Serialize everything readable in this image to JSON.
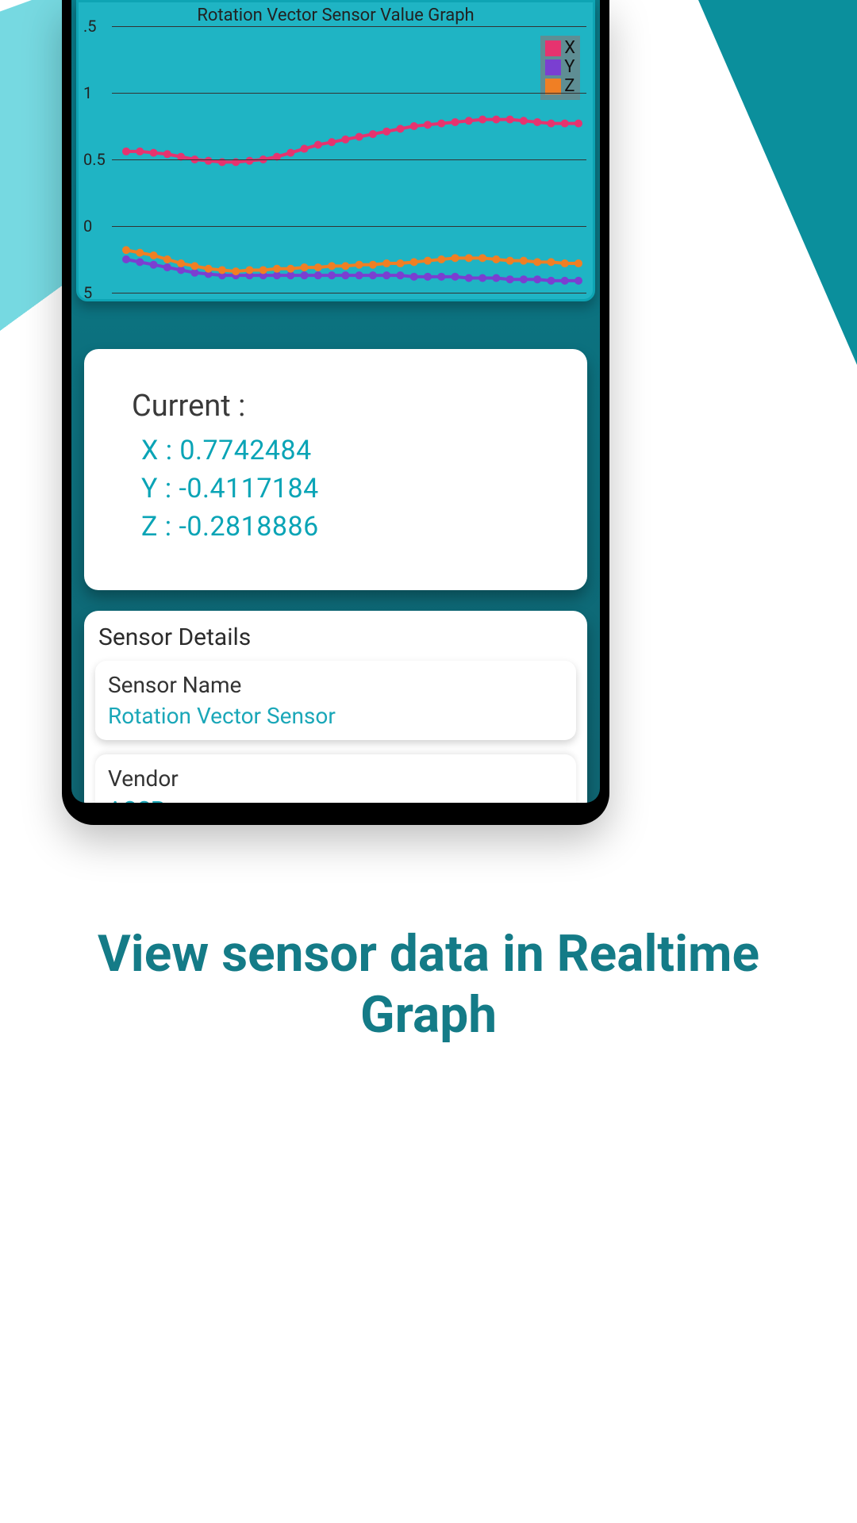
{
  "chart": {
    "title": "Rotation Vector Sensor Value Graph",
    "legend": {
      "x": "X",
      "y": "Y",
      "z": "Z"
    },
    "colors": {
      "x": "#e6336f",
      "y": "#7a3fd1",
      "z": "#f07f24"
    },
    "yticks": [
      ".5",
      "1",
      "0.5",
      "0",
      "5"
    ]
  },
  "chart_data": {
    "type": "line",
    "title": "Rotation Vector Sensor Value Graph",
    "xlabel": "",
    "ylabel": "",
    "ylim": [
      -0.5,
      1.5
    ],
    "x": [
      0,
      1,
      2,
      3,
      4,
      5,
      6,
      7,
      8,
      9,
      10,
      11,
      12,
      13,
      14,
      15,
      16,
      17,
      18,
      19,
      20,
      21,
      22,
      23,
      24,
      25,
      26,
      27,
      28,
      29,
      30,
      31,
      32,
      33
    ],
    "series": [
      {
        "name": "X",
        "color": "#e6336f",
        "values": [
          0.56,
          0.56,
          0.55,
          0.54,
          0.52,
          0.5,
          0.49,
          0.48,
          0.48,
          0.49,
          0.5,
          0.52,
          0.55,
          0.58,
          0.61,
          0.63,
          0.65,
          0.67,
          0.69,
          0.71,
          0.73,
          0.75,
          0.76,
          0.77,
          0.78,
          0.79,
          0.8,
          0.8,
          0.8,
          0.79,
          0.78,
          0.77,
          0.77,
          0.77
        ]
      },
      {
        "name": "Y",
        "color": "#7a3fd1",
        "values": [
          -0.25,
          -0.27,
          -0.29,
          -0.31,
          -0.33,
          -0.35,
          -0.36,
          -0.37,
          -0.37,
          -0.37,
          -0.37,
          -0.37,
          -0.37,
          -0.37,
          -0.37,
          -0.37,
          -0.37,
          -0.37,
          -0.37,
          -0.37,
          -0.37,
          -0.38,
          -0.38,
          -0.38,
          -0.38,
          -0.39,
          -0.39,
          -0.39,
          -0.4,
          -0.4,
          -0.4,
          -0.41,
          -0.41,
          -0.41
        ]
      },
      {
        "name": "Z",
        "color": "#f07f24",
        "values": [
          -0.18,
          -0.2,
          -0.22,
          -0.25,
          -0.28,
          -0.3,
          -0.32,
          -0.33,
          -0.34,
          -0.33,
          -0.33,
          -0.32,
          -0.32,
          -0.31,
          -0.31,
          -0.3,
          -0.3,
          -0.29,
          -0.29,
          -0.28,
          -0.28,
          -0.27,
          -0.26,
          -0.25,
          -0.24,
          -0.24,
          -0.24,
          -0.25,
          -0.26,
          -0.26,
          -0.27,
          -0.27,
          -0.28,
          -0.28
        ]
      }
    ]
  },
  "current": {
    "heading": "Current :",
    "x": "X : 0.7742484",
    "y": "Y : -0.4117184",
    "z": "Z : -0.2818886"
  },
  "details": {
    "heading": "Sensor Details",
    "rows": [
      {
        "label": "Sensor Name",
        "value": "Rotation Vector Sensor"
      },
      {
        "label": "Vendor",
        "value": "AOSP"
      }
    ]
  },
  "promo": "View sensor data in Realtime Graph"
}
